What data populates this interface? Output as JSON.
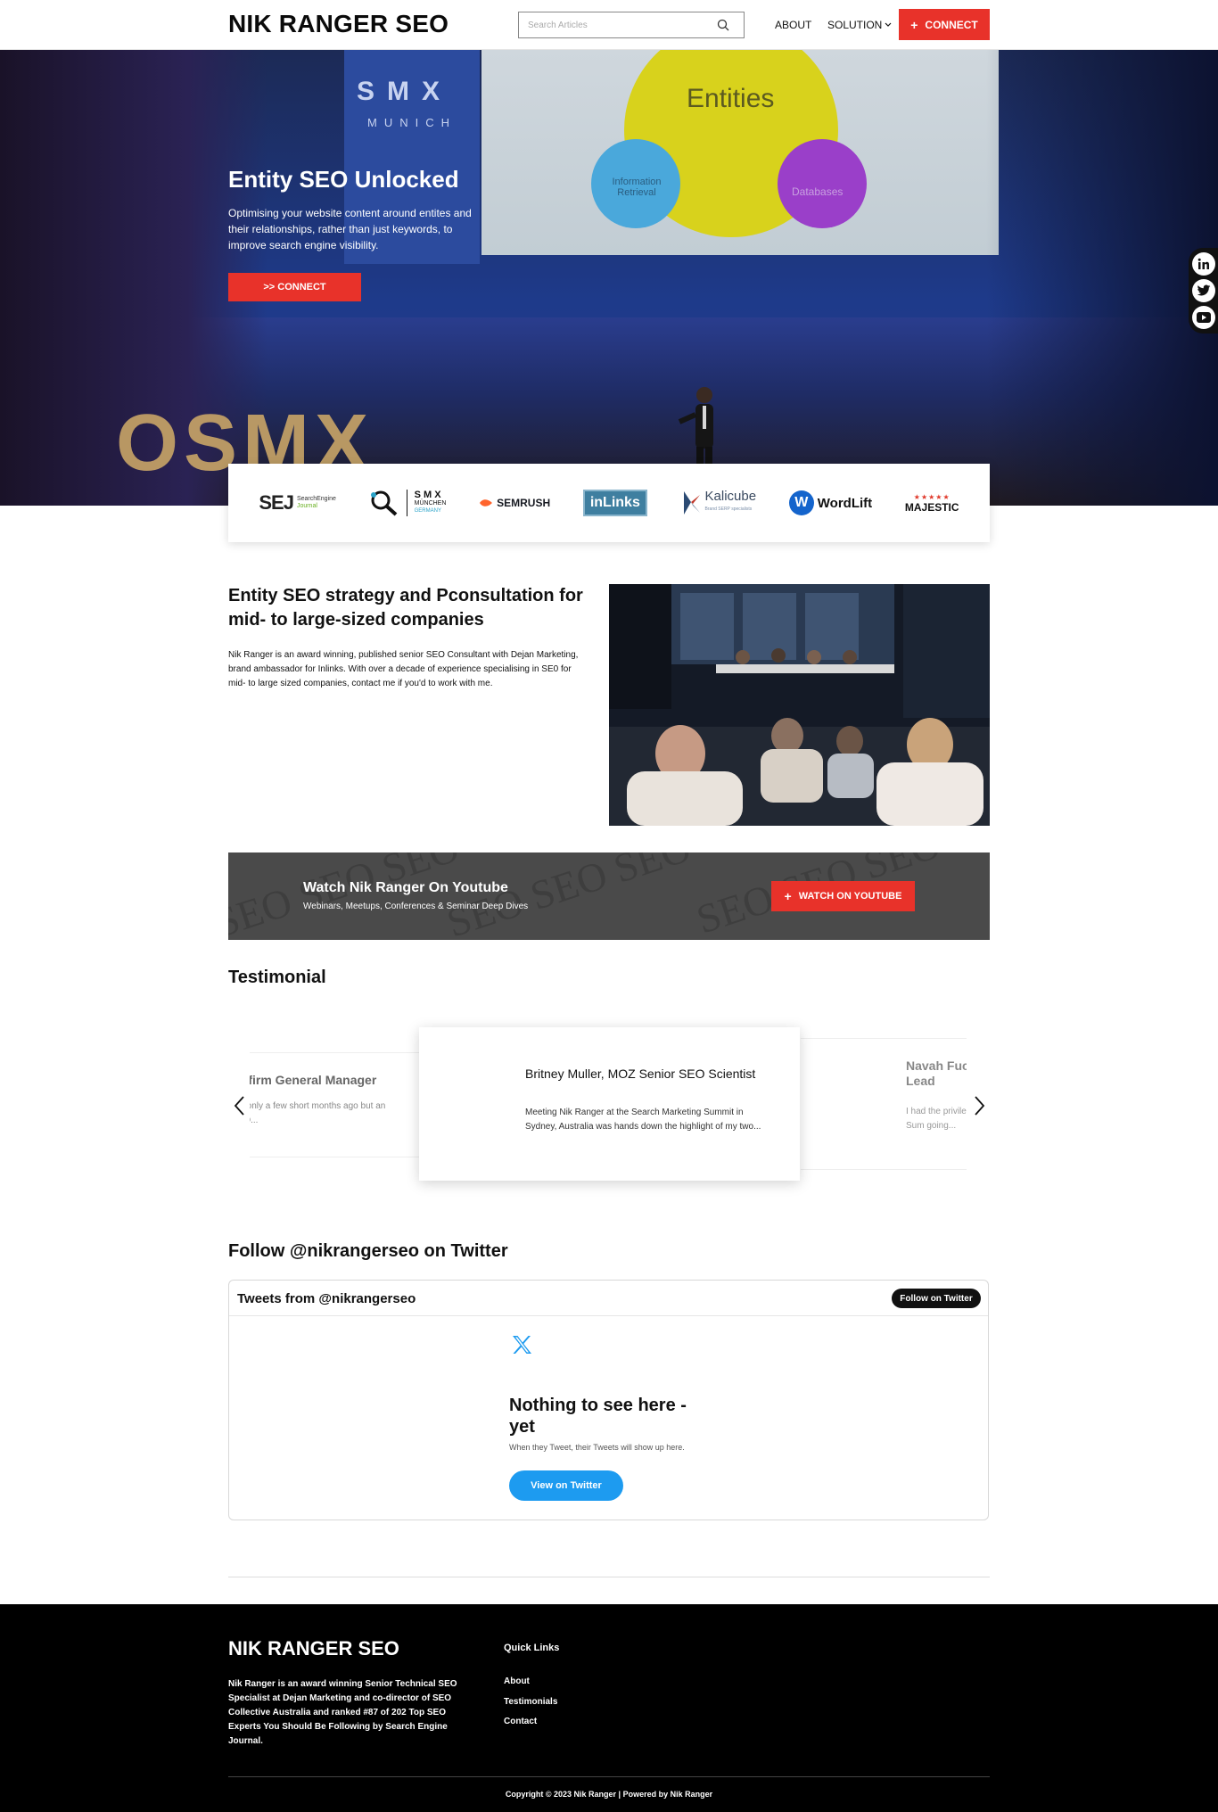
{
  "header": {
    "logo": "NIK RANGER SEO",
    "search_placeholder": "Search Articles",
    "nav": {
      "about": "ABOUT",
      "solution": "SOLUTION"
    },
    "connect_label": "CONNECT"
  },
  "hero": {
    "title": "Entity SEO Unlocked",
    "subtitle": "Optimising your website content around entites and their relationships, rather than just keywords, to improve search engine visibility.",
    "cta": ">> CONNECT",
    "photo_text": {
      "sign_top": "SMX",
      "sign_bottom": "MUNICH",
      "slide_main": "Entities",
      "slide_left": "Information Retrieval",
      "slide_right": "Databases",
      "stage_letters": "OSMX"
    }
  },
  "social": [
    "linkedin-icon",
    "twitter-icon",
    "youtube-icon"
  ],
  "logos": {
    "sej": {
      "mark": "SEJ",
      "text_top": "SearchEngine",
      "text_bottom": "Journal"
    },
    "smx": {
      "top": "S M X",
      "mid": "MÜNCHEN",
      "bottom": "GERMANY"
    },
    "semrush": "SEMRUSH",
    "inlinks": "inLinks",
    "kalicube": {
      "name": "Kalicube",
      "tag": "Brand SERP specialists"
    },
    "wordlift": {
      "mark": "W",
      "name": "WordLift"
    },
    "majestic": "MAJESTIC"
  },
  "strategy": {
    "title": "Entity SEO strategy and Pconsultation for mid- to large-sized companies",
    "body": "Nik Ranger is an award winning, published senior SEO Consultant with Dejan Marketing, brand ambassador for Inlinks. With over a decade of experience specialising in SE0 for mid- to large sized companies, contact me if you'd to work with me."
  },
  "youtube": {
    "watermark": "SEO SEO SEO",
    "title": "Watch Nik Ranger On Youtube",
    "subtitle": "Webinars, Meetups, Conferences & Seminar Deep Dives",
    "button": "WATCH ON YOUTUBE"
  },
  "testimonials": {
    "heading": "Testimonial",
    "left": {
      "name": "ebfirm General Manager",
      "text": "am only a few short months ago but an SEO..."
    },
    "center": {
      "name": "Britney Muller, MOZ Senior SEO Scientist",
      "text": "Meeting Nik Ranger at the Search Marketing Summit in Sydney, Australia was hands down the highlight of my two..."
    },
    "right": {
      "name": "Navah Fuc Team Lead",
      "text": "I had the privile Marketing Sum going..."
    }
  },
  "twitter": {
    "heading": "Follow @nikrangerseo on Twitter",
    "tweets_from": "Tweets from @nikrangerseo",
    "follow_button": "Follow on Twitter",
    "nothing": "Nothing to see here - yet",
    "when": "When they Tweet, their Tweets will show up here.",
    "view_button": "View on Twitter"
  },
  "footer": {
    "logo": "NIK RANGER SEO",
    "about": "Nik Ranger is an award winning Senior Technical SEO Specialist at Dejan Marketing and co-director of SEO Collective Australia and ranked #87 of 202 Top SEO Experts You Should Be Following by Search Engine Journal.",
    "quick_links_title": "Quick Links",
    "links": [
      "About",
      "Testimonials",
      "Contact"
    ],
    "copyright": "Copyright © 2023 Nik Ranger | Powered by Nik Ranger"
  },
  "colors": {
    "accent": "#e8322a",
    "twitter_blue": "#1d9bf0",
    "footer_bg": "#000000"
  }
}
